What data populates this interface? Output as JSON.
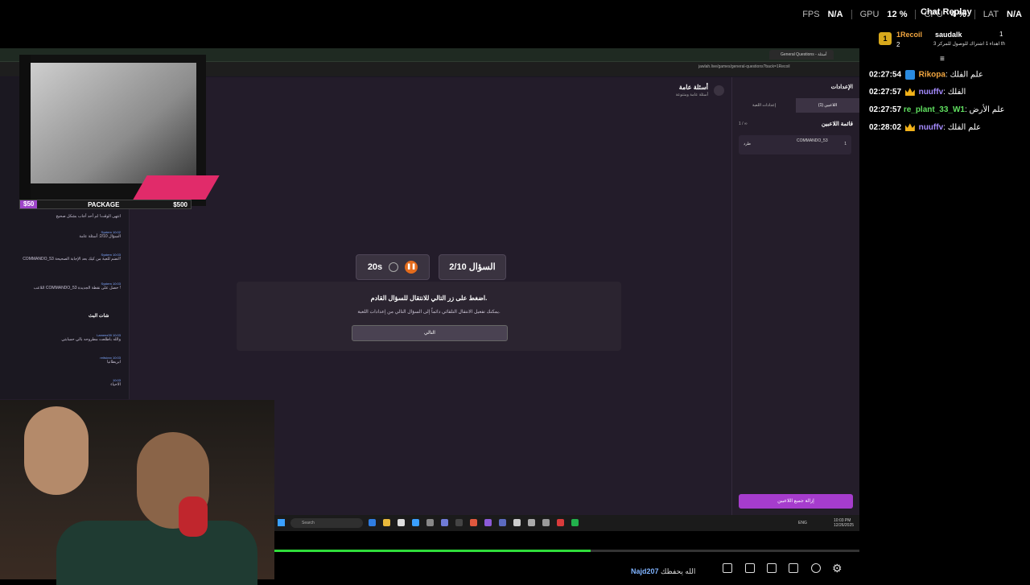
{
  "stats": {
    "fps_label": "FPS",
    "fps_value": "N/A",
    "gpu_label": "GPU",
    "gpu_value": "12 %",
    "cpu_label": "CPU",
    "cpu_value": "4 %",
    "lat_label": "LAT",
    "lat_value": "N/A"
  },
  "chat_replay_title": "Chat Replay",
  "leaderboard": {
    "rank1": "1",
    "user1": "1Recoil",
    "user1_score": "2",
    "user2": "saudalk",
    "user2_score": "1",
    "subline": "3 اهداء 1 اشتراك للوصول للمركز th"
  },
  "chat": [
    {
      "time": "02:27:54",
      "user": "Rikopa",
      "user_color": "#f2a640",
      "text": "علم الفلك",
      "badge": "blue"
    },
    {
      "time": "02:27:57",
      "user": "nuuffv",
      "user_color": "#a58bff",
      "text": "الفلك",
      "badge": "crown"
    },
    {
      "time": "02:27:57",
      "user": "re_plant_33_W1",
      "user_color": "#60e060",
      "text": "علم الأرض",
      "badge": "none"
    },
    {
      "time": "02:28:02",
      "user": "nuuffv",
      "user_color": "#a58bff",
      "text": "علم الفلك",
      "badge": "crown"
    }
  ],
  "browser": {
    "tab_title": "General Questions - أسئلة عامة",
    "url": "jawlah.live/games/general-questions?back=1Recoil"
  },
  "overlay_package": {
    "low": "$50",
    "label": "PACKAGE",
    "high": "$500"
  },
  "left_chat": {
    "messages": [
      {
        "who": "",
        "text": "انتهى الوقت! لم أحد أجاب بشكل صحيح"
      },
      {
        "who": "System 10:02",
        "text": "السؤال 2/10: أسئلة عامة"
      },
      {
        "who": "System 10:03",
        "text": "COMMANDO_53 انضم للعبة من كيك بعد الإجابة الصحيحة!"
      },
      {
        "who": "System 10:03",
        "text": "اللاعب COMMANDO_53 حصل على نقطة الجديدة !"
      }
    ],
    "section_title": "شات البث",
    "viewer_msgs": [
      {
        "who": "Lameez39 10:03",
        "text": "والله باطلعت مطروحه بالي حسابتي"
      },
      {
        "who": "reitsivxx 10:03",
        "text": "ابريطانيا"
      },
      {
        "who": "10:03",
        "text": "الاحياء"
      }
    ]
  },
  "game": {
    "title": "أسئلة عامة",
    "subtitle": "أسئلة عامة ومتنوعة",
    "timer": "20s",
    "question_counter": "السؤال 2/10",
    "prompt": "اضغط على زر التالي للانتقال للسؤال القادم.",
    "hint": "يمكنك تفعيل الانتقال التلقائي دائماً إلى السؤال التالي من إعدادات اللعبة.",
    "next_label": "التالي"
  },
  "settings": {
    "title": "الإعدادات",
    "tab_players": "اللاعبين (1)",
    "tab_game": "إعدادات اللعبة",
    "players_header": "قائمة اللاعبين",
    "players_count": "1 / ∞",
    "player_name": "COMMANDO_53",
    "player_score": "1",
    "kick_label": "طرد",
    "remove_all": "إزالة جميع اللاعبين"
  },
  "taskbar": {
    "search_placeholder": "Search",
    "lang": "ENG",
    "clock_time": "10:03 PM",
    "clock_date": "12/26/2025"
  },
  "playback": {
    "progress": 0.54
  },
  "bottom": {
    "user": "Najd207",
    "message": "الله يحفظك"
  }
}
